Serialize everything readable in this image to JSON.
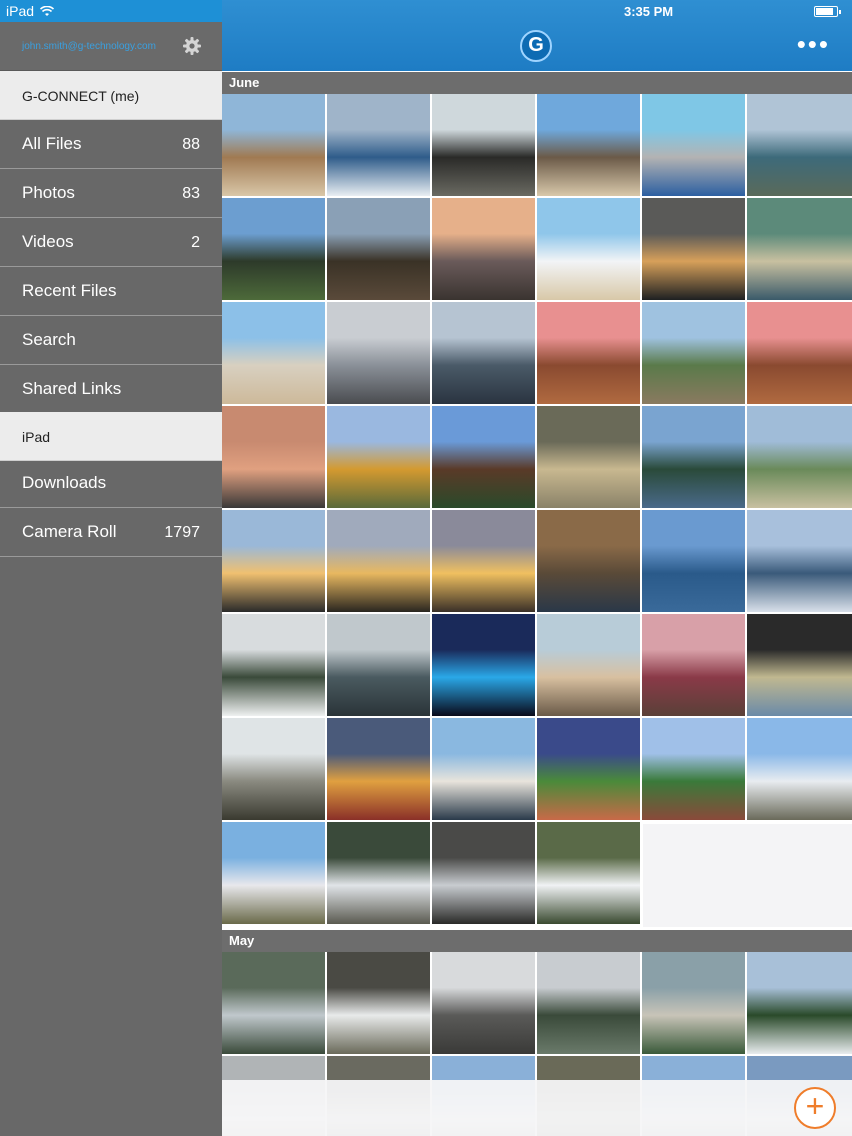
{
  "status_bar": {
    "device": "iPad",
    "time": "3:35 PM",
    "battery_level": 0.85
  },
  "account": {
    "email": "john.smith@g-technology.com",
    "settings_icon": "gear-icon"
  },
  "sidebar": {
    "items": [
      {
        "label": "G-CONNECT (me)",
        "count": "",
        "style": "light"
      },
      {
        "label": "All Files",
        "count": "88",
        "style": "dark"
      },
      {
        "label": "Photos",
        "count": "83",
        "style": "dark"
      },
      {
        "label": "Videos",
        "count": "2",
        "style": "dark"
      },
      {
        "label": "Recent Files",
        "count": "",
        "style": "dark"
      },
      {
        "label": "Search",
        "count": "",
        "style": "dark"
      },
      {
        "label": "Shared Links",
        "count": "",
        "style": "dark"
      },
      {
        "label": "iPad",
        "count": "",
        "style": "light"
      },
      {
        "label": "Downloads",
        "count": "",
        "style": "dark"
      },
      {
        "label": "Camera Roll",
        "count": "1797",
        "style": "dark"
      }
    ]
  },
  "header": {
    "logo_letter": "G",
    "more_icon": "more-dots-icon",
    "more_glyph": "•••"
  },
  "sections": [
    {
      "title": "June",
      "photo_count": 46,
      "palettes": [
        [
          "#8fb6d8",
          "#a07a52",
          "#d9c7a8"
        ],
        [
          "#9fb4c9",
          "#2f5c8a",
          "#e8eef3"
        ],
        [
          "#cfd8dc",
          "#2a2a28",
          "#6a6a62"
        ],
        [
          "#6fa8dc",
          "#6b5a48",
          "#d8c8aa"
        ],
        [
          "#7fc7e6",
          "#b3b3b3",
          "#2c5fa1"
        ],
        [
          "#b0c4d6",
          "#3d6a7a",
          "#5a6a5a"
        ],
        [
          "#6c9ed0",
          "#2d3a2a",
          "#4d6a3a"
        ],
        [
          "#8aa0b6",
          "#3a3226",
          "#5a4a3a"
        ],
        [
          "#e6b08a",
          "#6a5a5a",
          "#3a3430"
        ],
        [
          "#8fc6ea",
          "#f2f4f6",
          "#d8c8a8"
        ],
        [
          "#5a5a58",
          "#d7a05a",
          "#1e2022"
        ],
        [
          "#5c8a7a",
          "#c8c0a0",
          "#3a5a6a"
        ],
        [
          "#8cc0e8",
          "#d8d0c0",
          "#cdb99a"
        ],
        [
          "#c9cdd2",
          "#8a9098",
          "#4a4c50"
        ],
        [
          "#b6c4d2",
          "#4a5a68",
          "#2a3440"
        ],
        [
          "#e89090",
          "#8a4a30",
          "#b06a40"
        ],
        [
          "#9fc2e0",
          "#5a7a4a",
          "#8a7a60"
        ],
        [
          "#e89090",
          "#8a4a30",
          "#b06a40"
        ],
        [
          "#c88a70",
          "#e0a080",
          "#3a3838"
        ],
        [
          "#9ab8e0",
          "#d49a30",
          "#5a6a3a"
        ],
        [
          "#6a9ad8",
          "#5a3a28",
          "#2a4a2a"
        ],
        [
          "#6a6a58",
          "#c8b890",
          "#8a8268"
        ],
        [
          "#7aa4d0",
          "#2a4a3a",
          "#4a6a8a"
        ],
        [
          "#a0bcd8",
          "#6a8a5a",
          "#c8c0a0"
        ],
        [
          "#9ab8d8",
          "#f0c070",
          "#2a2a2a"
        ],
        [
          "#a0aabc",
          "#e8b860",
          "#2a2620"
        ],
        [
          "#8a8a9a",
          "#f0c060",
          "#3a3028"
        ],
        [
          "#8a6a48",
          "#5a4a38",
          "#2a3848"
        ],
        [
          "#6a9ad0",
          "#2a5a8a",
          "#3a6a9a"
        ],
        [
          "#a8c0dc",
          "#3a5a7a",
          "#d8e0ea"
        ],
        [
          "#d8dcde",
          "#3a4a3a",
          "#eef0f0"
        ],
        [
          "#c0c8cc",
          "#4a5a60",
          "#2a3438"
        ],
        [
          "#1a2a5a",
          "#2aa8e8",
          "#0a0a1a"
        ],
        [
          "#b8ccd8",
          "#d8c0a0",
          "#6a5a48"
        ],
        [
          "#d8a0a8",
          "#8a3a48",
          "#5a4038"
        ],
        [
          "#2a2a2a",
          "#c0b890",
          "#6a8aa8"
        ],
        [
          "#dfe4e6",
          "#8a8a80",
          "#3a3a30"
        ],
        [
          "#4a5a7a",
          "#e0a040",
          "#8a3028"
        ],
        [
          "#8ab8e0",
          "#e8e4dc",
          "#2a3a4a"
        ],
        [
          "#3a4a8a",
          "#4a8a3a",
          "#c86a48"
        ],
        [
          "#a0c0e8",
          "#3a7a3a",
          "#8a4a3a"
        ],
        [
          "#8ab8e8",
          "#e8ecf0",
          "#6a6a5a"
        ],
        [
          "#7ab0e0",
          "#e8e8ec",
          "#6a6a4a"
        ],
        [
          "#3a4a3a",
          "#e0e4e8",
          "#5a5a50"
        ],
        [
          "#4a4a48",
          "#c8ccd0",
          "#2a2a28"
        ],
        [
          "#5a6a48",
          "#f0f2f4",
          "#3a4a30"
        ]
      ]
    },
    {
      "title": "May",
      "photo_count": 12,
      "palettes": [
        [
          "#5a6a5a",
          "#c0c8cc",
          "#3a4a3a"
        ],
        [
          "#4a4a44",
          "#e8eaea",
          "#6a6a5a"
        ],
        [
          "#d8dadc",
          "#5a5a58",
          "#3a3a38"
        ],
        [
          "#c8ccd0",
          "#3a4a3a",
          "#6a7a6a"
        ],
        [
          "#8aa0a8",
          "#c8c4b8",
          "#3a5a3a"
        ],
        [
          "#a8c0d8",
          "#2a4a2a",
          "#e8ecee"
        ],
        [
          "#b0b4b6",
          "#e0e0e0",
          "#8a7a6a"
        ],
        [
          "#6a6a60",
          "#c8c8c0",
          "#3a3a30"
        ],
        [
          "#8ab0d8",
          "#e0e4e8",
          "#5a6a5a"
        ],
        [
          "#6a6a58",
          "#a0a490",
          "#3a3a30"
        ],
        [
          "#8ab0d8",
          "#d8dce0",
          "#5a6a5a"
        ],
        [
          "#7a9ac0",
          "#e0e4e8",
          "#4a5a4a"
        ]
      ]
    }
  ],
  "fab": {
    "label": "+",
    "icon": "plus-icon",
    "accent": "#ef7d2b"
  }
}
